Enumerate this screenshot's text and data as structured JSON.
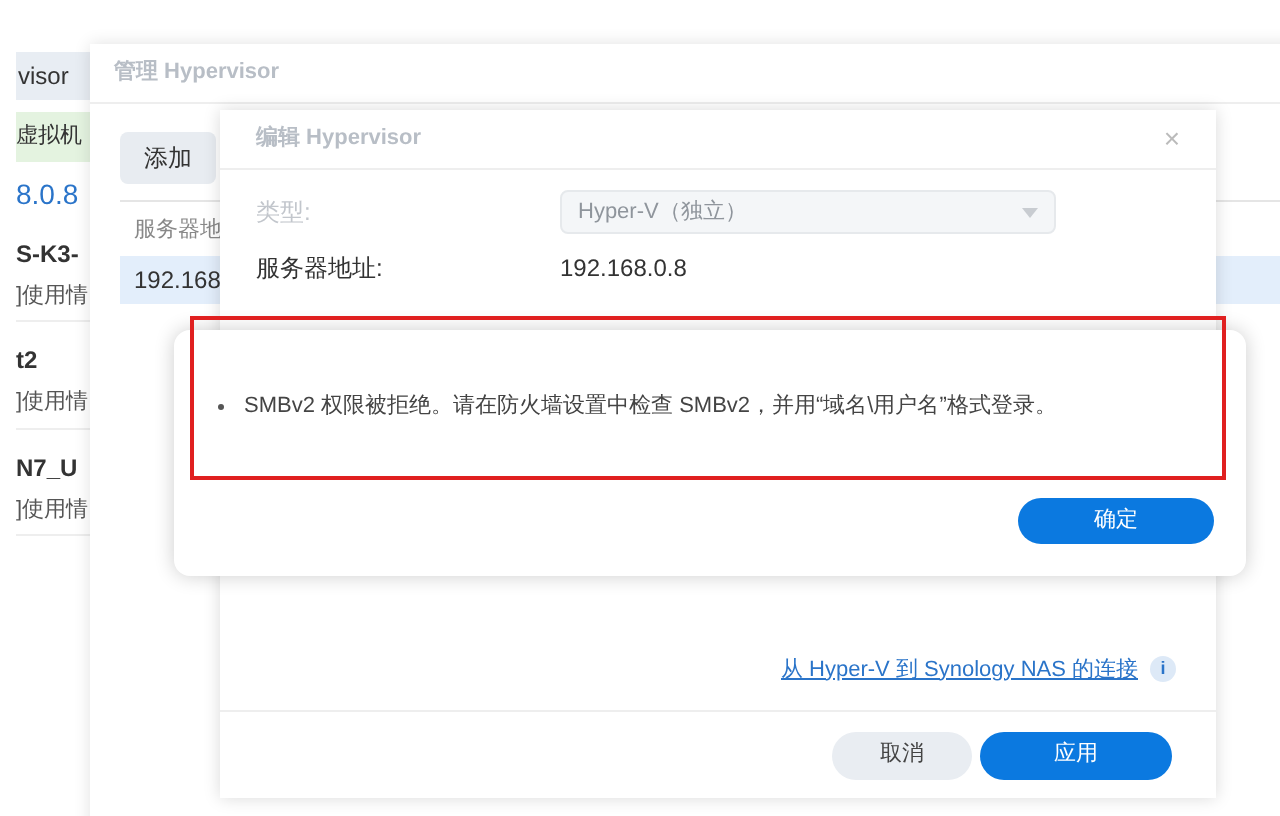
{
  "background_list": {
    "tab": "visor",
    "status": "虚拟机",
    "address": "8.0.8",
    "items": [
      {
        "name": "S-K3-",
        "detail": "]使用情"
      },
      {
        "name": "t2",
        "detail": "]使用情"
      },
      {
        "name": "N7_U",
        "detail": "]使用情"
      }
    ]
  },
  "manage_window": {
    "title": "管理 Hypervisor",
    "add_button": "添加",
    "table": {
      "column_1": "服务器地",
      "rows": [
        {
          "column_1": "192.168",
          "selected": true
        }
      ]
    }
  },
  "edit_window": {
    "title": "编辑 Hypervisor",
    "close": "×",
    "fields": [
      {
        "label": "类型:",
        "kind": "select",
        "value": "Hyper-V（独立）",
        "disabled": true
      },
      {
        "label": "服务器地址:",
        "kind": "text",
        "value": "192.168.0.8",
        "disabled": false
      }
    ],
    "link": "从 Hyper-V 到 Synology NAS 的连接",
    "info": "i",
    "buttons": [
      {
        "label": "取消",
        "primary": false
      },
      {
        "label": "应用",
        "primary": true
      }
    ]
  },
  "alert": {
    "messages": [
      "SMBv2 权限被拒绝。请在防火墙设置中检查 SMBv2，并用“域名\\用户名”格式登录。"
    ],
    "highlighted": true,
    "button": "确定"
  }
}
